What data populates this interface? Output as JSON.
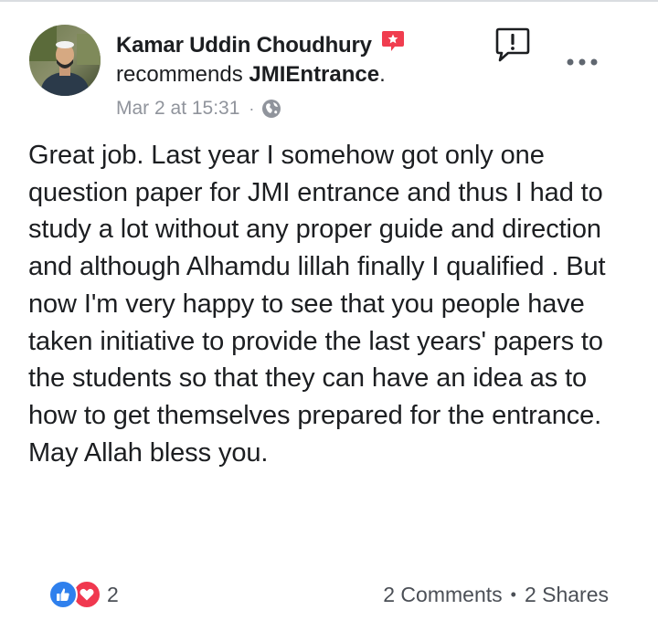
{
  "post": {
    "author": "Kamar Uddin Choudhury",
    "action": "recommends",
    "page": "JMIEntrance",
    "period": ".",
    "date": "Mar 2 at 15:31",
    "separator": "·",
    "body": "Great job. Last year I somehow got only one question paper for JMI entrance and thus I had to study a lot without any proper guide and direction and although Alhamdu lillah finally I qualified . But now I'm very happy to see that you people have taken initiative to provide the last years' papers to the students so that they can have an idea as to how to get themselves prepared for the entrance. May Allah bless you."
  },
  "footer": {
    "reaction_count": "2",
    "comments": "2 Comments",
    "bullet": "•",
    "shares": "2 Shares"
  },
  "colors": {
    "text": "#1c1e21",
    "meta": "#90949c",
    "like_blue": "#2f80ed",
    "love_red": "#f0384f",
    "badge_red": "#f03d4f"
  },
  "icons": [
    "avatar",
    "star-badge-icon",
    "globe-icon",
    "report-icon",
    "more-options-icon",
    "like-reaction-icon",
    "love-reaction-icon"
  ]
}
